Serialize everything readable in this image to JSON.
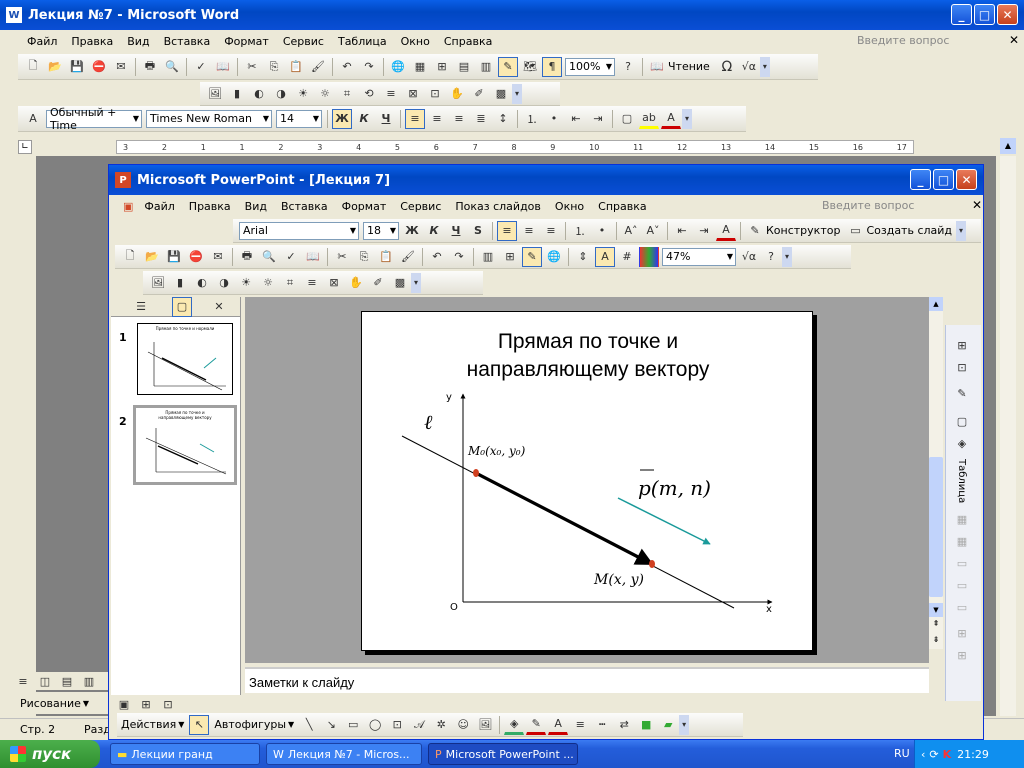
{
  "word": {
    "title": "Лекция №7 - Microsoft Word",
    "menu": [
      "Файл",
      "Правка",
      "Вид",
      "Вставка",
      "Формат",
      "Сервис",
      "Таблица",
      "Окно",
      "Справка"
    ],
    "ask": "Введите вопрос",
    "zoom": "100%",
    "read_label": "Чтение",
    "style": "Обычный + Time",
    "font": "Times New Roman",
    "size": "14",
    "status_page": "Стр.  2",
    "status_section": "Разд"
  },
  "ruler": [
    "3",
    "2",
    "1",
    "1",
    "2",
    "3",
    "4",
    "5",
    "6",
    "7",
    "8",
    "9",
    "10",
    "11",
    "12",
    "13",
    "14",
    "15",
    "16",
    "17"
  ],
  "ppt": {
    "title": "Microsoft PowerPoint - [Лекция 7]",
    "menu": [
      "Файл",
      "Правка",
      "Вид",
      "Вставка",
      "Формат",
      "Сервис",
      "Показ слайдов",
      "Окно",
      "Справка"
    ],
    "ask": "Введите вопрос",
    "font": "Arial",
    "size": "18",
    "designer": "Конструктор",
    "new_slide": "Создать слайд",
    "zoom": "47%",
    "notes": "Заметки к слайду",
    "drawing_bar": {
      "actions": "Действия",
      "autoshapes": "Автофигуры"
    },
    "taskpane_label": "Таблица"
  },
  "thumbnails": [
    {
      "num": "1",
      "title": "Прямая по точке и нормали"
    },
    {
      "num": "2",
      "title": "Прямая по точке и направляющему вектору"
    }
  ],
  "slide": {
    "title_line1": "Прямая по точке и",
    "title_line2": "направляющему вектору",
    "axis_y": "y",
    "axis_x": "x",
    "origin": "O",
    "line_label": "ℓ",
    "m0_label": "M₀(x₀, y₀)",
    "m_label": "M(x, y)",
    "p_label": "p(m, n)"
  },
  "word_drawing": "Рисование",
  "taskbar": {
    "start": "пуск",
    "items": [
      "Лекции гранд",
      "Лекция №7 - Micros...",
      "Microsoft PowerPoint ..."
    ],
    "lang": "RU",
    "time": "21:29"
  },
  "colors": {
    "xp_blue": "#0a4ed6",
    "teal_vector": "#1a9a9a",
    "point_red": "#d04020",
    "taskbar_green": "#3a9a3a"
  }
}
